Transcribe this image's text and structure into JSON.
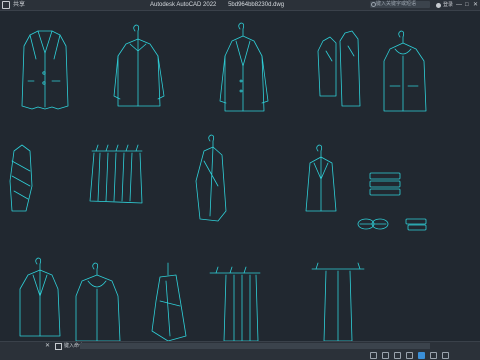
{
  "titlebar": {
    "share_label": "共享",
    "app_name": "Autodesk AutoCAD 2022",
    "file_name": "5bd964bb8230d.dwg",
    "search_placeholder": "键入关键字或短语",
    "user_label": "登录",
    "minimize": "—",
    "maximize": "□",
    "close": "✕"
  },
  "commandline": {
    "close_symbol": "✕",
    "prompt": "键入命令"
  },
  "icons": {
    "menu": "app-menu-icon",
    "search": "search-icon",
    "user": "user-icon",
    "command": "command-icon"
  },
  "colors": {
    "background": "#212830",
    "drawing_lines": "#2fd0d8",
    "panel": "#2b3139"
  }
}
